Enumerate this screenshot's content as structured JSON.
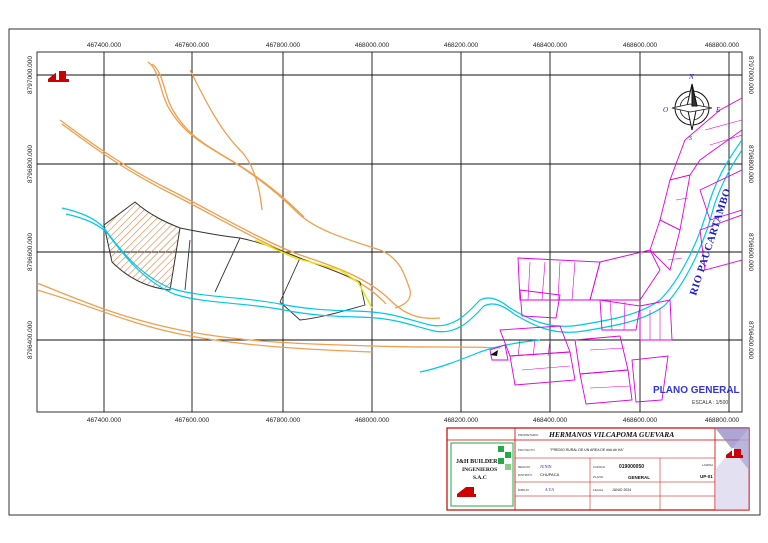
{
  "map": {
    "x_ticks_top": [
      "467400.000",
      "467600.000",
      "467800.000",
      "468000.000",
      "468200.000",
      "468400.000",
      "468600.000",
      "468800.000"
    ],
    "x_ticks_bottom": [
      "467400.000",
      "467600.000",
      "467800.000",
      "468000.000",
      "468200.000",
      "468400.000",
      "468600.000",
      "468800.000"
    ],
    "y_ticks_left": [
      "8797000.000",
      "8796800.000",
      "8796600.000",
      "8796400.000"
    ],
    "y_ticks_right": [
      "8797000.000",
      "8796800.000",
      "8796600.000",
      "8796400.000"
    ],
    "river_label": "RIO PAUCARTAMBO",
    "plan_title": "PLANO GENERAL",
    "scale_label": "ESCALA : 1/500",
    "compass": {
      "n": "N",
      "o": "O",
      "e": "E",
      "s": "S"
    },
    "colors": {
      "grid": "#111111",
      "river": "#00c8e6",
      "road": "#f0a050",
      "urban": "#e000e0",
      "hatch": "#d88040",
      "frame_red": "#cc0000",
      "green": "#22aa44",
      "yellow": "#e8e800"
    }
  },
  "title_block": {
    "owner_label": "PROPIETARIO",
    "owner": "HERMANOS VILCAPOMA GUEVARA",
    "project_label": "PROYECTO",
    "project": "\"PREDIO RURAL DE UN AREA DE ###.## HA\"",
    "company_line1": "J&H BUILDER",
    "company_line2": "INGENIEROS",
    "company_line3": "S.A.C",
    "location_label": "UBICACION",
    "region_label": "REGION",
    "region": "JUNIN",
    "district_label": "DISTRITO",
    "district": "CHUPACA",
    "code_label": "CODIGO",
    "code": "019000050",
    "sheet_label": "LAMINA",
    "sheet": "UP-01",
    "plan_label": "PLANO",
    "plan": "GENERAL",
    "drawn_label": "DIBUJO",
    "drawn": "A.V.A",
    "date_label": "FECHA",
    "date": "JUNIO 2024"
  }
}
